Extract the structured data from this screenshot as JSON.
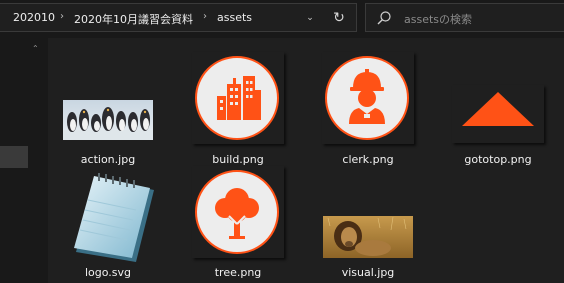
{
  "breadcrumb": {
    "items": [
      "202010",
      "2020年10月議習会資料",
      "assets"
    ],
    "separator": "›",
    "dropdown_glyph": "⌄",
    "refresh_glyph": "↻"
  },
  "search": {
    "placeholder": "assetsの検索",
    "icon": "search-icon"
  },
  "nav": {
    "scroll_up_glyph": "⌃"
  },
  "files": [
    {
      "name": "action.jpg",
      "kind": "photo-penguins"
    },
    {
      "name": "build.png",
      "kind": "icon-buildings"
    },
    {
      "name": "clerk.png",
      "kind": "icon-worker"
    },
    {
      "name": "gototop.png",
      "kind": "icon-triangle"
    },
    {
      "name": "logo.svg",
      "kind": "icon-notepad"
    },
    {
      "name": "tree.png",
      "kind": "icon-tree"
    },
    {
      "name": "visual.jpg",
      "kind": "photo-lion"
    }
  ],
  "colors": {
    "accent": "#ff5216",
    "background": "#191919",
    "pane": "#1f1f1f"
  }
}
